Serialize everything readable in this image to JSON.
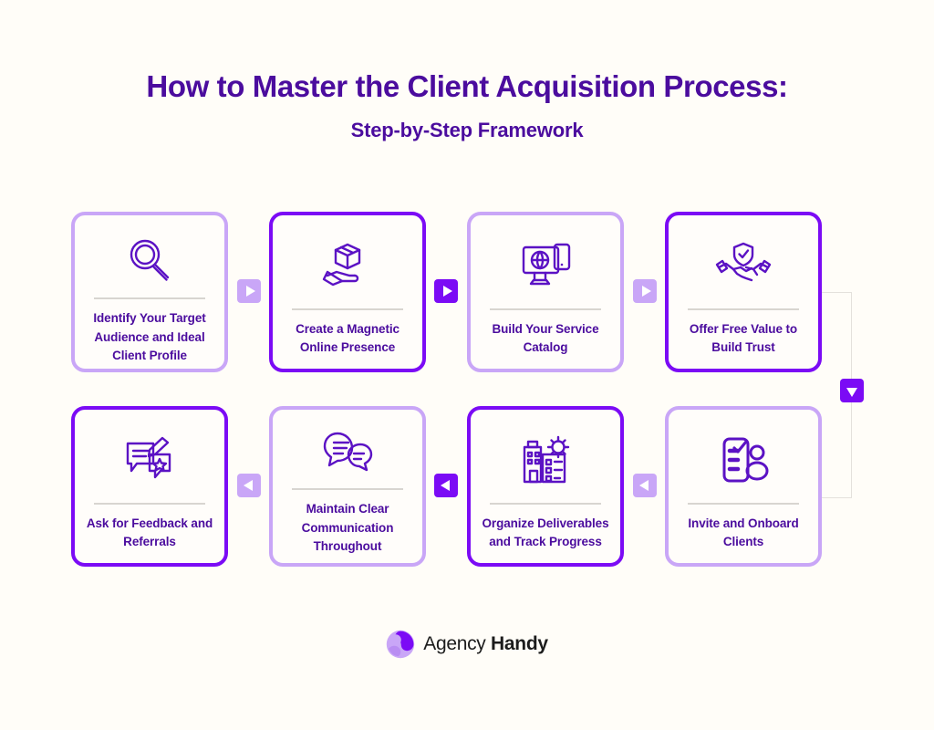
{
  "header": {
    "title": "How to Master the Client Acquisition Process:",
    "subtitle": "Step-by-Step Framework"
  },
  "colors": {
    "background": "#FFFDF8",
    "card_background": "#FFFDFA",
    "accent_strong": "#7B0BF5",
    "accent_light": "#C9A6F7",
    "text_purple": "#4B0C9E",
    "divider": "#D8D5D0",
    "connector": "#E4E1DC"
  },
  "steps": [
    {
      "label": "Identify Your Target Audience and Ideal Client Profile",
      "icon": "magnifying-glass-icon",
      "border": "light"
    },
    {
      "label": "Create a Magnetic Online Presence",
      "icon": "hand-holding-box-icon",
      "border": "strong"
    },
    {
      "label": "Build Your Service Catalog",
      "icon": "monitor-globe-phone-icon",
      "border": "light"
    },
    {
      "label": "Offer Free Value to Build Trust",
      "icon": "handshake-shield-icon",
      "border": "strong"
    },
    {
      "label": "Ask for Feedback and Referrals",
      "icon": "speech-bubble-pencil-star-icon",
      "border": "strong"
    },
    {
      "label": "Maintain Clear Communication Throughout",
      "icon": "chat-bubbles-icon",
      "border": "light"
    },
    {
      "label": "Organize Deliverables and Track Progress",
      "icon": "checklist-building-gear-icon",
      "border": "strong"
    },
    {
      "label": "Invite and Onboard Clients",
      "icon": "clipboard-people-icon",
      "border": "light"
    }
  ],
  "connectors": [
    {
      "name": "arrow-step1-to-step2",
      "direction": "right",
      "style": "light"
    },
    {
      "name": "arrow-step2-to-step3",
      "direction": "right",
      "style": "strong"
    },
    {
      "name": "arrow-step3-to-step4",
      "direction": "right",
      "style": "light"
    },
    {
      "name": "arrow-step4-to-step8",
      "direction": "down",
      "style": "strong"
    },
    {
      "name": "arrow-step8-to-step7",
      "direction": "left",
      "style": "light"
    },
    {
      "name": "arrow-step7-to-step6",
      "direction": "left",
      "style": "strong"
    },
    {
      "name": "arrow-step6-to-step5",
      "direction": "left",
      "style": "light"
    }
  ],
  "footer": {
    "brand_regular": "Agency",
    "brand_bold": "Handy"
  }
}
